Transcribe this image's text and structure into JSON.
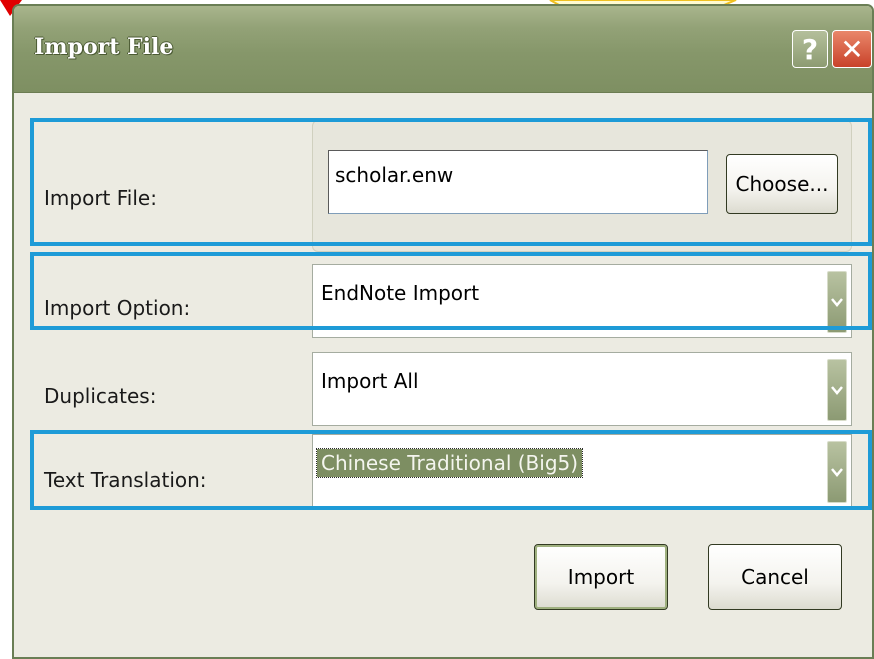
{
  "dialog": {
    "title": "Import File",
    "help_glyph": "?",
    "close_glyph": "✕"
  },
  "fields": {
    "import_file": {
      "label": "Import File:",
      "value": "scholar.enw",
      "choose_label": "Choose..."
    },
    "import_option": {
      "label": "Import Option:",
      "value": "EndNote Import"
    },
    "duplicates": {
      "label": "Duplicates:",
      "value": "Import All"
    },
    "text_translation": {
      "label": "Text Translation:",
      "value": "Chinese Traditional (Big5)"
    }
  },
  "buttons": {
    "import": "Import",
    "cancel": "Cancel"
  },
  "colors": {
    "highlight_border": "#1e9bd7",
    "titlebar": "#86976a",
    "callout_fill": "#fffbd0",
    "callout_stroke": "#f0c020",
    "arrow": "#e00000"
  },
  "icons": [
    "help-icon",
    "close-icon",
    "dropdown-arrow-icon"
  ]
}
